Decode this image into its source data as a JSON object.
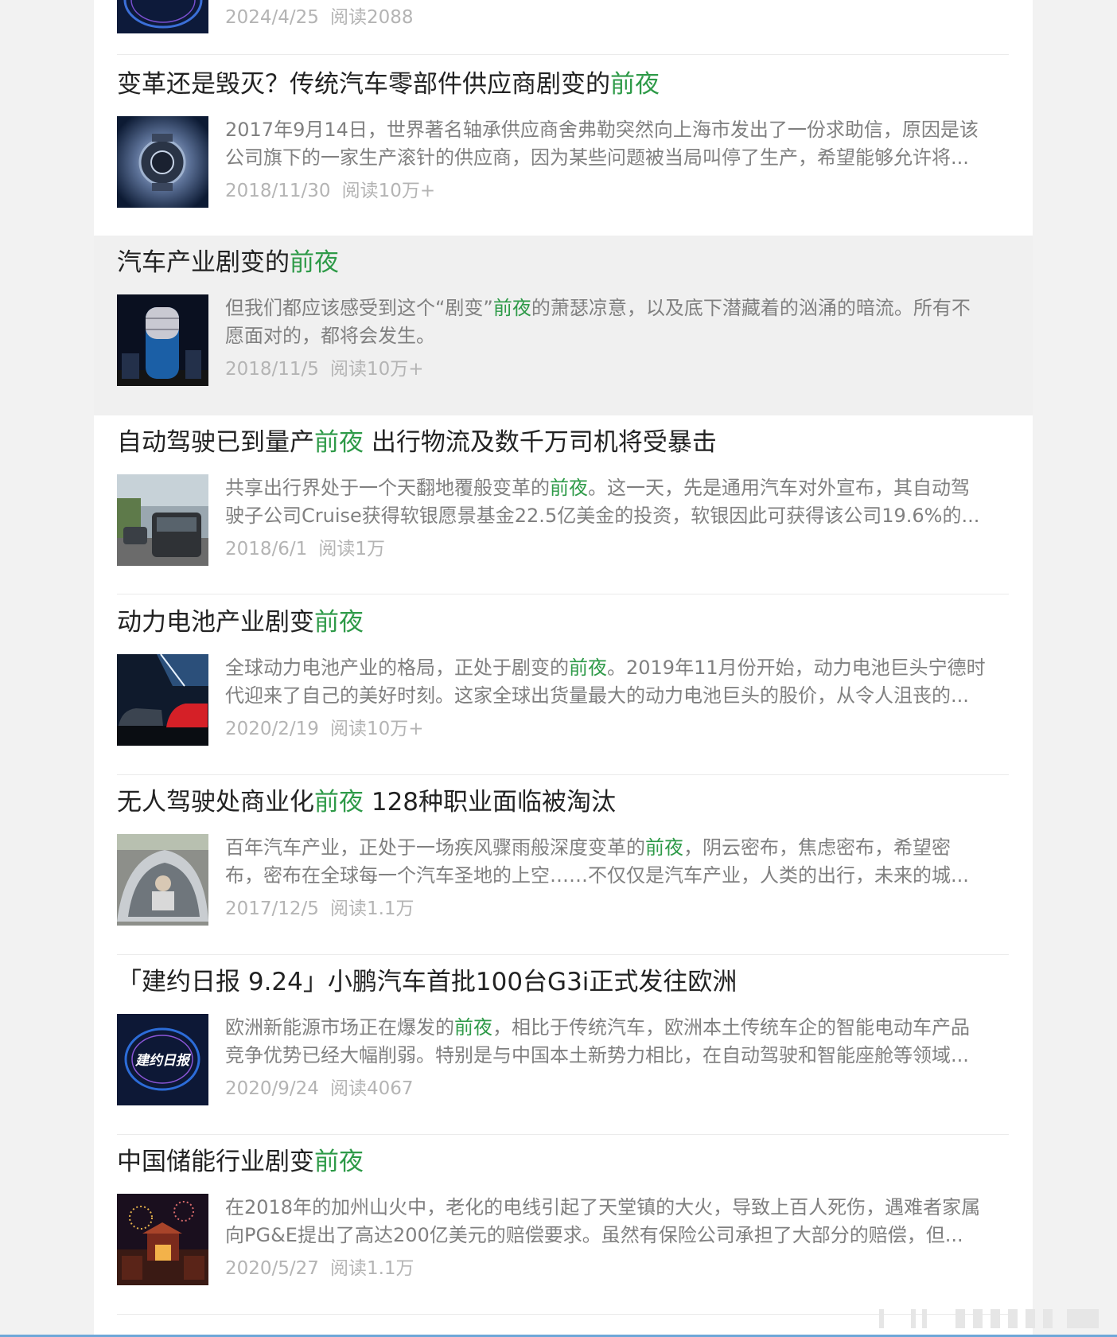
{
  "top_item": {
    "date": "2024/4/25",
    "reads": "阅读2088"
  },
  "items": [
    {
      "title_parts": [
        "变革还是毁灭？传统汽车零部件供应商剧变的",
        "前夜",
        ""
      ],
      "snippet_lines": [
        [
          "2017年9月14日，世界著名轴承供应商舍弗勒突然向上海市发出了一份求助信，原因是该",
          "",
          ""
        ],
        [
          "公司旗下的一家生产滚针的供应商，因为某些问题被当局叫停了生产，希望能够允许将...",
          "",
          ""
        ]
      ],
      "date": "2018/11/30",
      "reads": "阅读10万+"
    },
    {
      "title_parts": [
        "汽车产业剧变的",
        "前夜",
        ""
      ],
      "snippet_lines": [
        [
          "但我们都应该感受到这个“剧变”",
          "前夜",
          "的萧瑟凉意，以及底下潜藏着的汹涌的暗流。所有不"
        ],
        [
          "愿面对的，都将会发生。",
          "",
          ""
        ]
      ],
      "date": "2018/11/5",
      "reads": "阅读10万+"
    },
    {
      "title_parts": [
        "自动驾驶已到量产",
        "前夜",
        " 出行物流及数千万司机将受暴击"
      ],
      "snippet_lines": [
        [
          "共享出行界处于一个天翻地覆般变革的",
          "前夜",
          "。这一天，先是通用汽车对外宣布，其自动驾"
        ],
        [
          "驶子公司Cruise获得软银愿景基金22.5亿美金的投资，软银因此可获得该公司19.6%的...",
          "",
          ""
        ]
      ],
      "date": "2018/6/1",
      "reads": "阅读1万"
    },
    {
      "title_parts": [
        "动力电池产业剧变",
        "前夜",
        ""
      ],
      "snippet_lines": [
        [
          "全球动力电池产业的格局，正处于剧变的",
          "前夜",
          "。2019年11月份开始，动力电池巨头宁德时"
        ],
        [
          "代迎来了自己的美好时刻。这家全球出货量最大的动力电池巨头的股价，从令人沮丧的...",
          "",
          ""
        ]
      ],
      "date": "2020/2/19",
      "reads": "阅读10万+"
    },
    {
      "title_parts": [
        "无人驾驶处商业化",
        "前夜",
        " 128种职业面临被淘汰"
      ],
      "snippet_lines": [
        [
          "百年汽车产业，正处于一场疾风骤雨般深度变革的",
          "前夜",
          "，阴云密布，焦虑密布，希望密"
        ],
        [
          "布，密布在全球每一个汽车圣地的上空……不仅仅是汽车产业，人类的出行，未来的城...",
          "",
          ""
        ]
      ],
      "date": "2017/12/5",
      "reads": "阅读1.1万"
    },
    {
      "title_parts": [
        "「建约日报 9.24」小鹏汽车首批100台G3i正式发往欧洲",
        "",
        ""
      ],
      "snippet_lines": [
        [
          "欧洲新能源市场正在爆发的",
          "前夜",
          "，相比于传统汽车，欧洲本土传统车企的智能电动车产品"
        ],
        [
          "竞争优势已经大幅削弱。特别是与中国本土新势力相比，在自动驾驶和智能座舱等领域...",
          "",
          ""
        ]
      ],
      "date": "2020/9/24",
      "reads": "阅读4067",
      "thumb_text": "建约日报"
    },
    {
      "title_parts": [
        "中国储能行业剧变",
        "前夜",
        ""
      ],
      "snippet_lines": [
        [
          "在2018年的加州山火中，老化的电线引起了天堂镇的大火，导致上百人死伤，遇难者家属",
          "",
          ""
        ],
        [
          "向PG&E提出了高达200亿美元的赔偿要求。虽然有保险公司承担了大部分的赔偿，但...",
          "",
          ""
        ]
      ],
      "date": "2020/5/27",
      "reads": "阅读1.1万"
    }
  ],
  "colors": {
    "highlight": "#2e9a48",
    "title": "#222222",
    "snippet": "#808080",
    "meta": "#b4b4b4",
    "hover_bg": "#f0f0f0"
  }
}
